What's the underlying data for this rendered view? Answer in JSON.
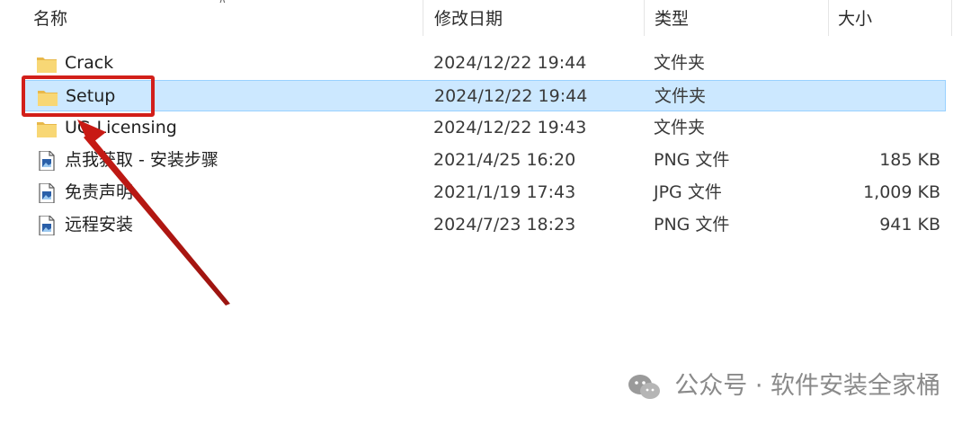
{
  "header": {
    "name": "名称",
    "date_modified": "修改日期",
    "type": "类型",
    "size": "大小"
  },
  "files": [
    {
      "name": "Crack",
      "date": "2024/12/22 19:44",
      "type": "文件夹",
      "size": "",
      "icon": "folder-icon"
    },
    {
      "name": "Setup",
      "date": "2024/12/22 19:44",
      "type": "文件夹",
      "size": "",
      "icon": "folder-icon",
      "selected": true
    },
    {
      "name": "UG-Licensing",
      "date": "2024/12/22 19:43",
      "type": "文件夹",
      "size": "",
      "icon": "folder-icon"
    },
    {
      "name": "点我获取 - 安装步骤",
      "date": "2021/4/25 16:20",
      "type": "PNG 文件",
      "size": "185 KB",
      "icon": "image-file-icon"
    },
    {
      "name": "免责声明",
      "date": "2021/1/19 17:43",
      "type": "JPG 文件",
      "size": "1,009 KB",
      "icon": "image-file-icon"
    },
    {
      "name": "远程安装",
      "date": "2024/7/23 18:23",
      "type": "PNG 文件",
      "size": "941 KB",
      "icon": "image-file-icon"
    }
  ],
  "watermark": "公众号 · 软件安装全家桶",
  "colors": {
    "selection_bg": "#cce8ff",
    "selection_border": "#99d1ff",
    "annotation_red": "#d21f1a",
    "folder_yellow": "#f8d775"
  }
}
